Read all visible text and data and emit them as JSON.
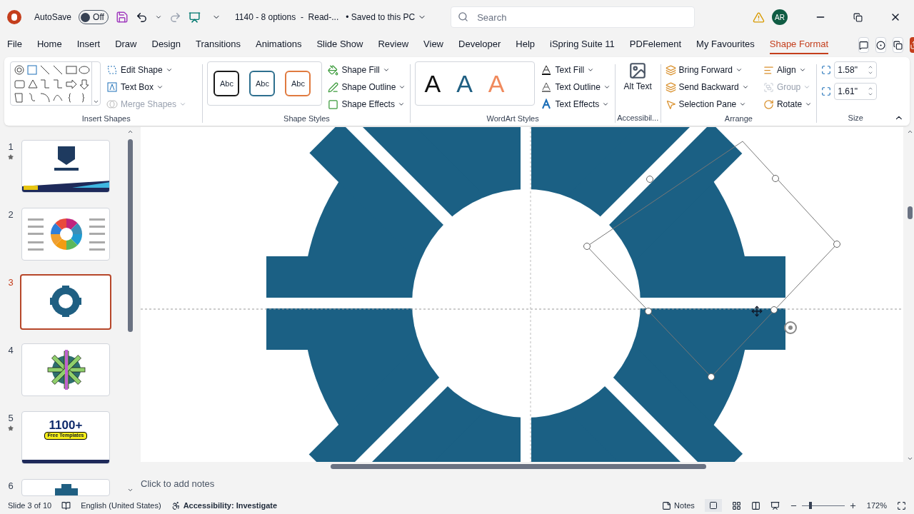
{
  "title_bar": {
    "autosave_label": "AutoSave",
    "autosave": {
      "label": "Off",
      "on": false
    },
    "document": "1140 - 8 options  -  Read-...",
    "save_status": "• Saved to this PC",
    "search": {
      "placeholder": "Search"
    },
    "avatar": "AR"
  },
  "tabs": [
    {
      "label": "File",
      "selected": false
    },
    {
      "label": "Home",
      "selected": false
    },
    {
      "label": "Insert",
      "selected": false
    },
    {
      "label": "Draw",
      "selected": false
    },
    {
      "label": "Design",
      "selected": false
    },
    {
      "label": "Transitions",
      "selected": false
    },
    {
      "label": "Animations",
      "selected": false
    },
    {
      "label": "Slide Show",
      "selected": false
    },
    {
      "label": "Review",
      "selected": false
    },
    {
      "label": "View",
      "selected": false
    },
    {
      "label": "Developer",
      "selected": false
    },
    {
      "label": "Help",
      "selected": false
    },
    {
      "label": "iSpring Suite 11",
      "selected": false
    },
    {
      "label": "PDFelement",
      "selected": false
    },
    {
      "label": "My Favourites",
      "selected": false
    },
    {
      "label": "Shape Format",
      "selected": true
    }
  ],
  "ribbon": {
    "insert_shapes": {
      "label": "Insert Shapes",
      "commands": [
        {
          "label": "Edit Shape",
          "disabled": false
        },
        {
          "label": "Text Box",
          "disabled": false
        },
        {
          "label": "Merge Shapes",
          "disabled": true
        }
      ]
    },
    "shape_styles": {
      "label": "Shape Styles",
      "samples": [
        {
          "text": "Abc",
          "color": "#1a1a1a"
        },
        {
          "text": "Abc",
          "color": "#2e6f8e"
        },
        {
          "text": "Abc",
          "color": "#e07a3f"
        }
      ],
      "commands": [
        {
          "label": "Shape Fill",
          "disabled": false
        },
        {
          "label": "Shape Outline",
          "disabled": false
        },
        {
          "label": "Shape Effects",
          "disabled": false
        }
      ]
    },
    "wordart_styles": {
      "label": "WordArt Styles",
      "samples": [
        {
          "text": "A",
          "color": "#111111"
        },
        {
          "text": "A",
          "color": "#1f5f82"
        },
        {
          "text": "A",
          "color": "#f08a5d"
        }
      ],
      "commands": [
        {
          "label": "Text Fill",
          "disabled": false
        },
        {
          "label": "Text Outline",
          "disabled": false
        },
        {
          "label": "Text Effects",
          "disabled": false
        }
      ]
    },
    "accessibility": {
      "label": "Accessibil...",
      "button": "Alt Text"
    },
    "arrange": {
      "label": "Arrange",
      "commands": [
        {
          "label": "Bring Forward",
          "disabled": false
        },
        {
          "label": "Align",
          "disabled": false
        },
        {
          "label": "Send Backward",
          "disabled": false
        },
        {
          "label": "Group",
          "disabled": true
        },
        {
          "label": "Selection Pane",
          "disabled": false
        },
        {
          "label": "Rotate",
          "disabled": false
        }
      ]
    },
    "size": {
      "label": "Size",
      "height": "1.58\"",
      "width": "1.61\""
    }
  },
  "slides": [
    {
      "number": "1",
      "starred": true,
      "selected": false,
      "kind": "title"
    },
    {
      "number": "2",
      "starred": false,
      "selected": false,
      "kind": "wheel"
    },
    {
      "number": "3",
      "starred": false,
      "selected": true,
      "kind": "gear"
    },
    {
      "number": "4",
      "starred": false,
      "selected": false,
      "kind": "star"
    },
    {
      "number": "5",
      "starred": true,
      "selected": false,
      "kind": "promo",
      "headline": "1100+",
      "banner": "Free Templates"
    },
    {
      "number": "6",
      "starred": false,
      "selected": false,
      "kind": "partial"
    }
  ],
  "notes": {
    "placeholder": "Click to add notes"
  },
  "status_bar": {
    "slide": "Slide 3 of 10",
    "language": "English (United States)",
    "accessibility": "Accessibility: Investigate",
    "notes": "Notes",
    "zoom": "172%",
    "zoom_slider": {
      "level": 0.2
    }
  }
}
